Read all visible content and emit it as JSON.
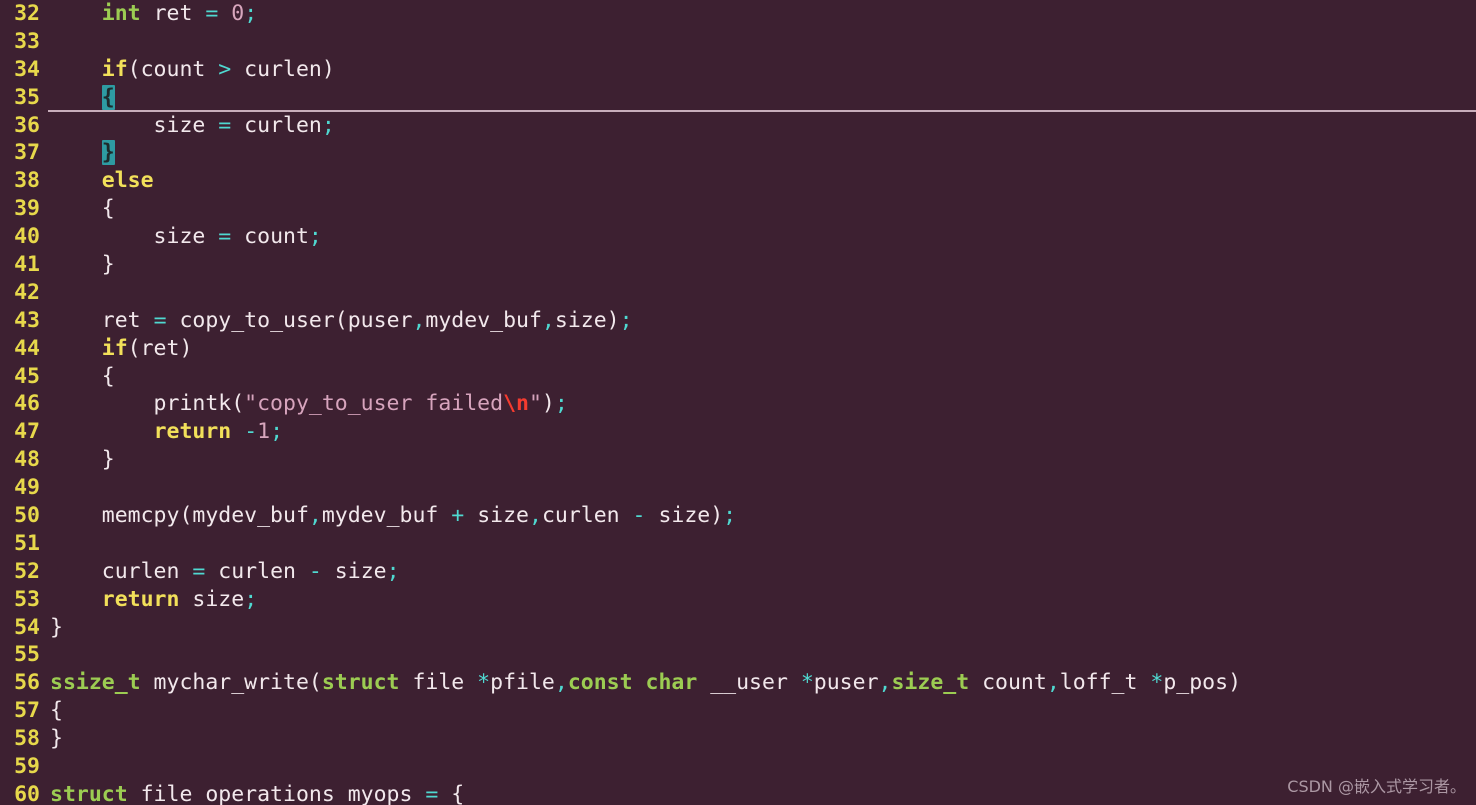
{
  "editor": {
    "language": "C",
    "theme_background": "#3d2031",
    "line_number_color": "#e7d84b",
    "default_text_color": "#f2e8ec",
    "cursor_line": 35,
    "matching_brace_lines": [
      35,
      37
    ],
    "brace_highlight_color": "#2e9ba2",
    "first_visible_line": 32,
    "last_visible_line": 60
  },
  "watermark": {
    "text": "CSDN @嵌入式学习者。"
  },
  "lines": [
    {
      "n": "32",
      "tokens": [
        {
          "t": "    ",
          "c": "t-plain"
        },
        {
          "t": "int",
          "c": "t-type"
        },
        {
          "t": " ret ",
          "c": "t-plain"
        },
        {
          "t": "=",
          "c": "t-op"
        },
        {
          "t": " ",
          "c": "t-plain"
        },
        {
          "t": "0",
          "c": "t-num"
        },
        {
          "t": ";",
          "c": "t-op"
        }
      ]
    },
    {
      "n": "33",
      "tokens": []
    },
    {
      "n": "34",
      "tokens": [
        {
          "t": "    ",
          "c": "t-plain"
        },
        {
          "t": "if",
          "c": "t-kw"
        },
        {
          "t": "(count ",
          "c": "t-plain"
        },
        {
          "t": ">",
          "c": "t-op"
        },
        {
          "t": " curlen)",
          "c": "t-plain"
        }
      ]
    },
    {
      "n": "35",
      "tokens": [
        {
          "t": "    ",
          "c": "t-plain"
        },
        {
          "t": "{",
          "c": "brace-hl"
        }
      ]
    },
    {
      "n": "36",
      "tokens": [
        {
          "t": "        size ",
          "c": "t-plain"
        },
        {
          "t": "=",
          "c": "t-op"
        },
        {
          "t": " curlen",
          "c": "t-plain"
        },
        {
          "t": ";",
          "c": "t-op"
        }
      ]
    },
    {
      "n": "37",
      "tokens": [
        {
          "t": "    ",
          "c": "t-plain"
        },
        {
          "t": "}",
          "c": "brace-hl"
        }
      ]
    },
    {
      "n": "38",
      "tokens": [
        {
          "t": "    ",
          "c": "t-plain"
        },
        {
          "t": "else",
          "c": "t-kw"
        }
      ]
    },
    {
      "n": "39",
      "tokens": [
        {
          "t": "    {",
          "c": "t-punct"
        }
      ]
    },
    {
      "n": "40",
      "tokens": [
        {
          "t": "        size ",
          "c": "t-plain"
        },
        {
          "t": "=",
          "c": "t-op"
        },
        {
          "t": " count",
          "c": "t-plain"
        },
        {
          "t": ";",
          "c": "t-op"
        }
      ]
    },
    {
      "n": "41",
      "tokens": [
        {
          "t": "    }",
          "c": "t-punct"
        }
      ]
    },
    {
      "n": "42",
      "tokens": []
    },
    {
      "n": "43",
      "tokens": [
        {
          "t": "    ret ",
          "c": "t-plain"
        },
        {
          "t": "=",
          "c": "t-op"
        },
        {
          "t": " copy_to_user(puser",
          "c": "t-plain"
        },
        {
          "t": ",",
          "c": "t-op"
        },
        {
          "t": "mydev_buf",
          "c": "t-plain"
        },
        {
          "t": ",",
          "c": "t-op"
        },
        {
          "t": "size)",
          "c": "t-plain"
        },
        {
          "t": ";",
          "c": "t-op"
        }
      ]
    },
    {
      "n": "44",
      "tokens": [
        {
          "t": "    ",
          "c": "t-plain"
        },
        {
          "t": "if",
          "c": "t-kw"
        },
        {
          "t": "(ret)",
          "c": "t-plain"
        }
      ]
    },
    {
      "n": "45",
      "tokens": [
        {
          "t": "    {",
          "c": "t-punct"
        }
      ]
    },
    {
      "n": "46",
      "tokens": [
        {
          "t": "        printk(",
          "c": "t-plain"
        },
        {
          "t": "\"copy_to_user failed",
          "c": "t-str"
        },
        {
          "t": "\\n",
          "c": "t-esc"
        },
        {
          "t": "\"",
          "c": "t-str"
        },
        {
          "t": ")",
          "c": "t-plain"
        },
        {
          "t": ";",
          "c": "t-op"
        }
      ]
    },
    {
      "n": "47",
      "tokens": [
        {
          "t": "        ",
          "c": "t-plain"
        },
        {
          "t": "return",
          "c": "t-kw"
        },
        {
          "t": " ",
          "c": "t-plain"
        },
        {
          "t": "-",
          "c": "t-op"
        },
        {
          "t": "1",
          "c": "t-num"
        },
        {
          "t": ";",
          "c": "t-op"
        }
      ]
    },
    {
      "n": "48",
      "tokens": [
        {
          "t": "    }",
          "c": "t-punct"
        }
      ]
    },
    {
      "n": "49",
      "tokens": []
    },
    {
      "n": "50",
      "tokens": [
        {
          "t": "    memcpy(mydev_buf",
          "c": "t-plain"
        },
        {
          "t": ",",
          "c": "t-op"
        },
        {
          "t": "mydev_buf ",
          "c": "t-plain"
        },
        {
          "t": "+",
          "c": "t-op"
        },
        {
          "t": " size",
          "c": "t-plain"
        },
        {
          "t": ",",
          "c": "t-op"
        },
        {
          "t": "curlen ",
          "c": "t-plain"
        },
        {
          "t": "-",
          "c": "t-op"
        },
        {
          "t": " size)",
          "c": "t-plain"
        },
        {
          "t": ";",
          "c": "t-op"
        }
      ]
    },
    {
      "n": "51",
      "tokens": []
    },
    {
      "n": "52",
      "tokens": [
        {
          "t": "    curlen ",
          "c": "t-plain"
        },
        {
          "t": "=",
          "c": "t-op"
        },
        {
          "t": " curlen ",
          "c": "t-plain"
        },
        {
          "t": "-",
          "c": "t-op"
        },
        {
          "t": " size",
          "c": "t-plain"
        },
        {
          "t": ";",
          "c": "t-op"
        }
      ]
    },
    {
      "n": "53",
      "tokens": [
        {
          "t": "    ",
          "c": "t-plain"
        },
        {
          "t": "return",
          "c": "t-kw"
        },
        {
          "t": " size",
          "c": "t-plain"
        },
        {
          "t": ";",
          "c": "t-op"
        }
      ]
    },
    {
      "n": "54",
      "tokens": [
        {
          "t": "}",
          "c": "t-punct"
        }
      ]
    },
    {
      "n": "55",
      "tokens": []
    },
    {
      "n": "56",
      "tokens": [
        {
          "t": "ssize_t",
          "c": "t-type"
        },
        {
          "t": " mychar_write(",
          "c": "t-plain"
        },
        {
          "t": "struct",
          "c": "t-type"
        },
        {
          "t": " file ",
          "c": "t-plain"
        },
        {
          "t": "*",
          "c": "t-op"
        },
        {
          "t": "pfile",
          "c": "t-plain"
        },
        {
          "t": ",",
          "c": "t-op"
        },
        {
          "t": "const",
          "c": "t-type"
        },
        {
          "t": " ",
          "c": "t-plain"
        },
        {
          "t": "char",
          "c": "t-type"
        },
        {
          "t": " __user ",
          "c": "t-plain"
        },
        {
          "t": "*",
          "c": "t-op"
        },
        {
          "t": "puser",
          "c": "t-plain"
        },
        {
          "t": ",",
          "c": "t-op"
        },
        {
          "t": "size_t",
          "c": "t-type"
        },
        {
          "t": " count",
          "c": "t-plain"
        },
        {
          "t": ",",
          "c": "t-op"
        },
        {
          "t": "loff_t ",
          "c": "t-plain"
        },
        {
          "t": "*",
          "c": "t-op"
        },
        {
          "t": "p_pos)",
          "c": "t-plain"
        }
      ]
    },
    {
      "n": "57",
      "tokens": [
        {
          "t": "{",
          "c": "t-punct"
        }
      ]
    },
    {
      "n": "58",
      "tokens": [
        {
          "t": "}",
          "c": "t-punct"
        }
      ]
    },
    {
      "n": "59",
      "tokens": []
    },
    {
      "n": "60",
      "tokens": [
        {
          "t": "struct",
          "c": "t-type"
        },
        {
          "t": " file_operations myops ",
          "c": "t-plain"
        },
        {
          "t": "=",
          "c": "t-op"
        },
        {
          "t": " {",
          "c": "t-punct"
        }
      ]
    }
  ]
}
